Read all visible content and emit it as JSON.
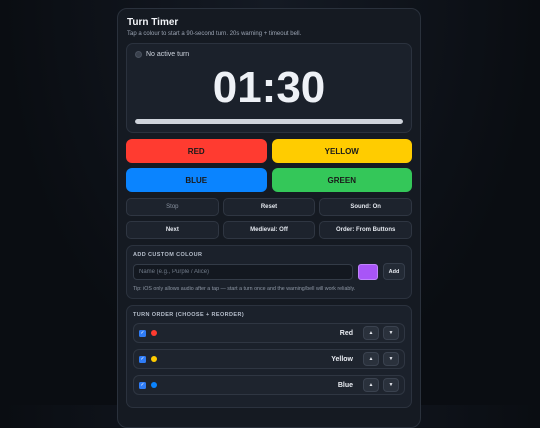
{
  "header": {
    "title": "Turn Timer",
    "subtitle": "Tap a colour to start a 90-second turn. 20s warning + timeout bell."
  },
  "timer": {
    "status": "No active turn",
    "time": "01:30",
    "progress_fraction": 1.0
  },
  "color_buttons": [
    {
      "label": "RED",
      "color": "#ff3b30"
    },
    {
      "label": "YELLOW",
      "color": "#ffcc00"
    },
    {
      "label": "BLUE",
      "color": "#0a84ff"
    },
    {
      "label": "GREEN",
      "color": "#34c759"
    }
  ],
  "controls": {
    "stop": "Stop",
    "reset": "Reset",
    "sound": "Sound: On",
    "next": "Next",
    "medieval": "Medieval: Off",
    "order": "Order: From Buttons"
  },
  "custom_colour": {
    "heading": "ADD CUSTOM COLOUR",
    "placeholder": "Name (e.g., Purple / Alice)",
    "swatch_color": "#a855f7",
    "add_label": "Add",
    "tip": "Tip: iOS only allows audio after a tap — start a turn once and the warning/bell will work reliably."
  },
  "turn_order": {
    "heading": "TURN ORDER (CHOOSE + REORDER)",
    "up_icon": "▲",
    "down_icon": "▼",
    "items": [
      {
        "label": "Red",
        "color": "#ff3b30",
        "checked": true
      },
      {
        "label": "Yellow",
        "color": "#ffcc00",
        "checked": true
      },
      {
        "label": "Blue",
        "color": "#0a84ff",
        "checked": true
      }
    ]
  }
}
